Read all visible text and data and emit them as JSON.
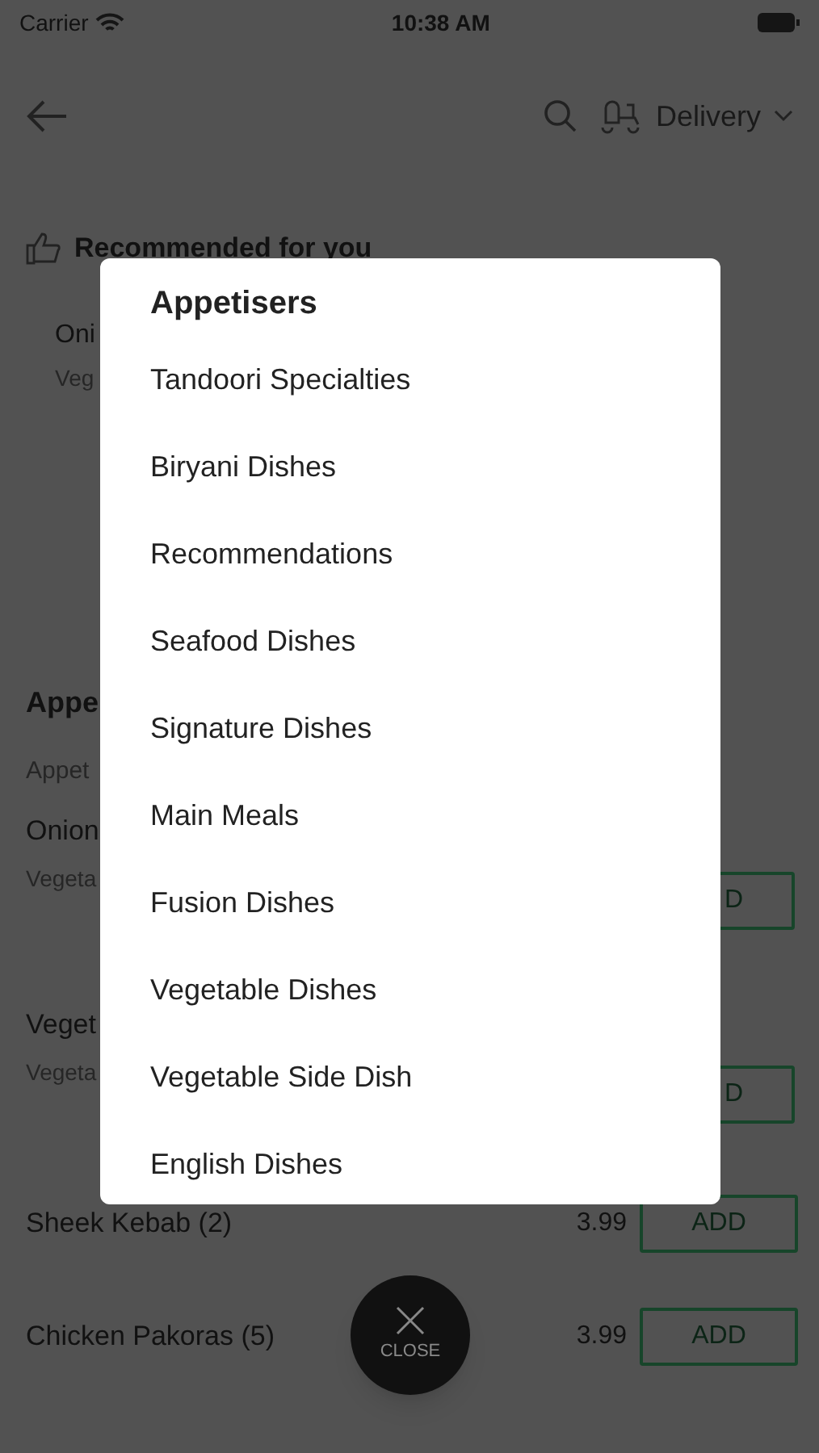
{
  "status_bar": {
    "carrier": "Carrier",
    "time": "10:38 AM"
  },
  "header": {
    "delivery_label": "Delivery"
  },
  "recommended": {
    "title": "Recommended for you",
    "item_name": "Oni",
    "item_category": "Veg"
  },
  "section": {
    "title": "Appe",
    "subtitle": "Appet"
  },
  "items": [
    {
      "kind": "covered",
      "name": "Onion",
      "category": "Vegeta",
      "button": "D"
    },
    {
      "kind": "covered",
      "name": "Veget",
      "category": "Vegeta",
      "button": "D"
    },
    {
      "kind": "priced",
      "name": "Sheek Kebab (2)",
      "price": "3.99",
      "button": "ADD"
    },
    {
      "kind": "priced",
      "name": "Chicken Pakoras (5)",
      "price": "3.99",
      "button": "ADD"
    }
  ],
  "category_menu": {
    "title": "Appetisers",
    "items": [
      "Tandoori Specialties",
      "Biryani Dishes",
      "Recommendations",
      "Seafood Dishes",
      "Signature Dishes",
      "Main Meals",
      "Fusion Dishes",
      "Vegetable Dishes",
      "Vegetable Side Dish",
      "English Dishes"
    ]
  },
  "close_button": {
    "label": "CLOSE"
  }
}
